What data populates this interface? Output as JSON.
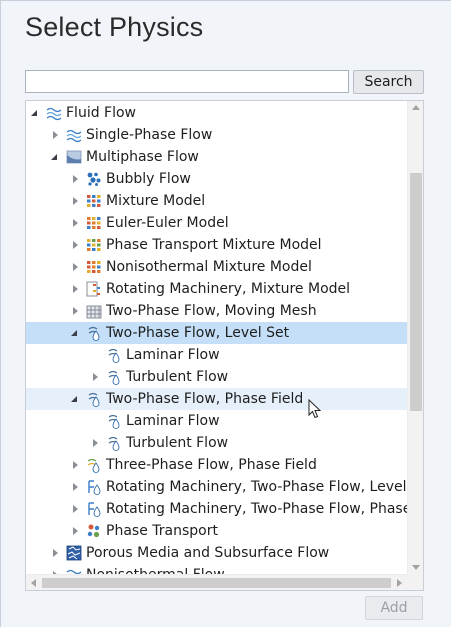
{
  "title": "Select Physics",
  "search": {
    "value": "",
    "placeholder": "",
    "button_label": "Search"
  },
  "tree": {
    "items": [
      {
        "label": "Fluid Flow",
        "icon": "fluid-flow-icon",
        "depth": 0,
        "state": "expanded"
      },
      {
        "label": "Single-Phase Flow",
        "icon": "single-phase-flow-icon",
        "depth": 1,
        "state": "collapsed"
      },
      {
        "label": "Multiphase Flow",
        "icon": "multiphase-flow-icon",
        "depth": 1,
        "state": "expanded"
      },
      {
        "label": "Bubbly Flow",
        "icon": "bubbly-flow-icon",
        "depth": 2,
        "state": "collapsed"
      },
      {
        "label": "Mixture Model",
        "icon": "mixture-model-icon",
        "depth": 2,
        "state": "collapsed"
      },
      {
        "label": "Euler-Euler Model",
        "icon": "euler-euler-model-icon",
        "depth": 2,
        "state": "collapsed"
      },
      {
        "label": "Phase Transport Mixture Model",
        "icon": "phase-transport-mixture-icon",
        "depth": 2,
        "state": "collapsed"
      },
      {
        "label": "Nonisothermal Mixture Model",
        "icon": "nonisothermal-mixture-icon",
        "depth": 2,
        "state": "collapsed"
      },
      {
        "label": "Rotating Machinery, Mixture Model",
        "icon": "rotating-machinery-mixture-icon",
        "depth": 2,
        "state": "collapsed"
      },
      {
        "label": "Two-Phase Flow, Moving Mesh",
        "icon": "moving-mesh-icon",
        "depth": 2,
        "state": "collapsed"
      },
      {
        "label": "Two-Phase Flow, Level Set",
        "icon": "level-set-icon",
        "depth": 2,
        "state": "expanded",
        "selected": true
      },
      {
        "label": "Laminar Flow",
        "icon": "laminar-flow-icon",
        "depth": 3,
        "state": "leaf"
      },
      {
        "label": "Turbulent Flow",
        "icon": "turbulent-flow-icon",
        "depth": 3,
        "state": "collapsed"
      },
      {
        "label": "Two-Phase Flow, Phase Field",
        "icon": "phase-field-icon",
        "depth": 2,
        "state": "expanded",
        "hover": true
      },
      {
        "label": "Laminar Flow",
        "icon": "laminar-flow-icon",
        "depth": 3,
        "state": "leaf"
      },
      {
        "label": "Turbulent Flow",
        "icon": "turbulent-flow-icon",
        "depth": 3,
        "state": "collapsed"
      },
      {
        "label": "Three-Phase Flow, Phase Field",
        "icon": "three-phase-flow-icon",
        "depth": 2,
        "state": "collapsed"
      },
      {
        "label": "Rotating Machinery, Two-Phase Flow, Level Set",
        "icon": "rotating-machinery-level-set-icon",
        "depth": 2,
        "state": "collapsed"
      },
      {
        "label": "Rotating Machinery, Two-Phase Flow, Phase Field",
        "icon": "rotating-machinery-phase-field-icon",
        "depth": 2,
        "state": "collapsed"
      },
      {
        "label": "Phase Transport",
        "icon": "phase-transport-icon",
        "depth": 2,
        "state": "collapsed"
      },
      {
        "label": "Porous Media and Subsurface Flow",
        "icon": "porous-media-icon",
        "depth": 1,
        "state": "collapsed"
      },
      {
        "label": "Nonisothermal Flow",
        "icon": "nonisothermal-flow-icon",
        "depth": 1,
        "state": "collapsed"
      }
    ]
  },
  "add_button_label": "Add",
  "colors": {
    "selected": "#c4dff7",
    "hover": "#e6f0fa",
    "accent": "#1f7fd4"
  }
}
